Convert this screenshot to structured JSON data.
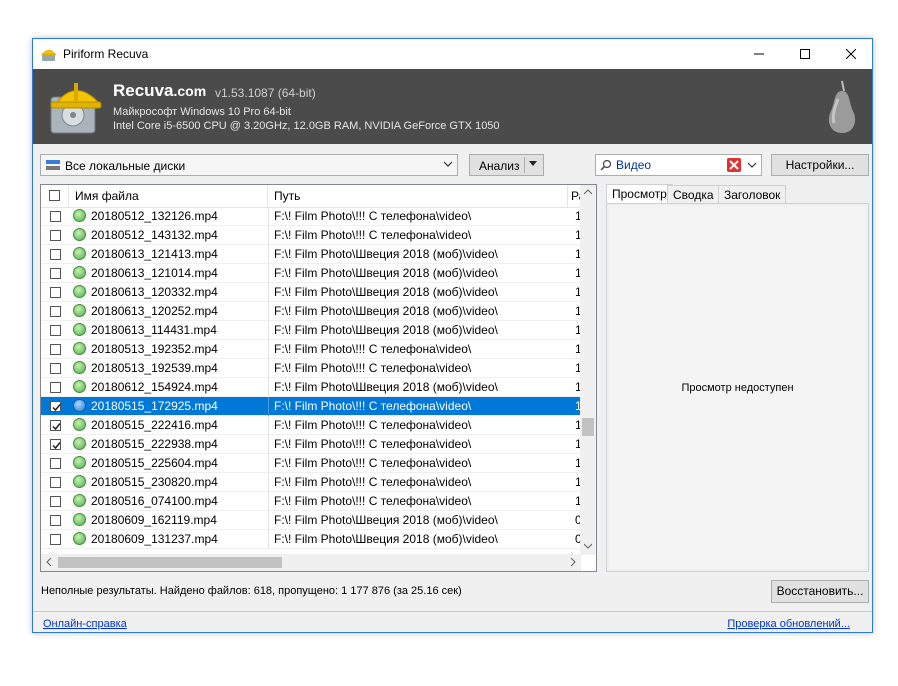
{
  "window": {
    "title": "Piriform Recuva"
  },
  "header": {
    "app_name": "Recuva",
    "app_domain": ".com",
    "version": "v1.53.1087 (64-bit)",
    "os_info": "Майкрософт Windows 10 Pro 64-bit",
    "hw_info": "Intel Core i5-6500 CPU @ 3.20GHz, 12.0GB RAM, NVIDIA GeForce GTX 1050"
  },
  "toolbar": {
    "drive_select": "Все локальные диски",
    "scan_button": "Анализ",
    "filter_value": "Видео",
    "settings_button": "Настройки..."
  },
  "list": {
    "columns": [
      "Имя файла",
      "Путь",
      "Размер"
    ],
    "rows": [
      {
        "name": "20180512_132126.mp4",
        "path": "F:\\! Film Photo\\!!! С телефона\\video\\",
        "size": "1",
        "checked": false,
        "selected": false
      },
      {
        "name": "20180512_143132.mp4",
        "path": "F:\\! Film Photo\\!!! С телефона\\video\\",
        "size": "1",
        "checked": false,
        "selected": false
      },
      {
        "name": "20180613_121413.mp4",
        "path": "F:\\! Film Photo\\Швеция 2018 (моб)\\video\\",
        "size": "1",
        "checked": false,
        "selected": false
      },
      {
        "name": "20180613_121014.mp4",
        "path": "F:\\! Film Photo\\Швеция 2018 (моб)\\video\\",
        "size": "1",
        "checked": false,
        "selected": false
      },
      {
        "name": "20180613_120332.mp4",
        "path": "F:\\! Film Photo\\Швеция 2018 (моб)\\video\\",
        "size": "1",
        "checked": false,
        "selected": false
      },
      {
        "name": "20180613_120252.mp4",
        "path": "F:\\! Film Photo\\Швеция 2018 (моб)\\video\\",
        "size": "1",
        "checked": false,
        "selected": false
      },
      {
        "name": "20180613_114431.mp4",
        "path": "F:\\! Film Photo\\Швеция 2018 (моб)\\video\\",
        "size": "1",
        "checked": false,
        "selected": false
      },
      {
        "name": "20180513_192352.mp4",
        "path": "F:\\! Film Photo\\!!! С телефона\\video\\",
        "size": "1",
        "checked": false,
        "selected": false
      },
      {
        "name": "20180513_192539.mp4",
        "path": "F:\\! Film Photo\\!!! С телефона\\video\\",
        "size": "1",
        "checked": false,
        "selected": false
      },
      {
        "name": "20180612_154924.mp4",
        "path": "F:\\! Film Photo\\Швеция 2018 (моб)\\video\\",
        "size": "1",
        "checked": false,
        "selected": false
      },
      {
        "name": "20180515_172925.mp4",
        "path": "F:\\! Film Photo\\!!! С телефона\\video\\",
        "size": "1",
        "checked": true,
        "selected": true
      },
      {
        "name": "20180515_222416.mp4",
        "path": "F:\\! Film Photo\\!!! С телефона\\video\\",
        "size": "1",
        "checked": true,
        "selected": false
      },
      {
        "name": "20180515_222938.mp4",
        "path": "F:\\! Film Photo\\!!! С телефона\\video\\",
        "size": "1",
        "checked": true,
        "selected": false
      },
      {
        "name": "20180515_225604.mp4",
        "path": "F:\\! Film Photo\\!!! С телефона\\video\\",
        "size": "1",
        "checked": false,
        "selected": false
      },
      {
        "name": "20180515_230820.mp4",
        "path": "F:\\! Film Photo\\!!! С телефона\\video\\",
        "size": "1",
        "checked": false,
        "selected": false
      },
      {
        "name": "20180516_074100.mp4",
        "path": "F:\\! Film Photo\\!!! С телефона\\video\\",
        "size": "1",
        "checked": false,
        "selected": false
      },
      {
        "name": "20180609_162119.mp4",
        "path": "F:\\! Film Photo\\Швеция 2018 (моб)\\video\\",
        "size": "0",
        "checked": false,
        "selected": false
      },
      {
        "name": "20180609_131237.mp4",
        "path": "F:\\! Film Photo\\Швеция 2018 (моб)\\video\\",
        "size": "0",
        "checked": false,
        "selected": false
      }
    ]
  },
  "tabs": [
    "Просмотр",
    "Сводка",
    "Заголовок"
  ],
  "preview": {
    "message": "Просмотр недоступен"
  },
  "status": {
    "text": "Неполные результаты. Найдено файлов: 618, пропущено: 1 177 876 (за 25.16 сек)",
    "restore_button": "Восстановить..."
  },
  "footer": {
    "help_link": "Онлайн-справка",
    "update_link": "Проверка обновлений..."
  },
  "colors": {
    "selection": "#0078d7",
    "header_bg": "#4b4b4b",
    "status_ok": "#4caf50",
    "link": "#0033cc"
  },
  "icons": {
    "app": "recuva-hardhat-icon",
    "status": "green-circle-icon"
  }
}
